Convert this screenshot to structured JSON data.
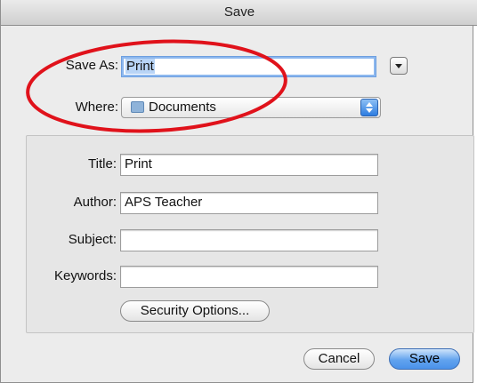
{
  "dialog": {
    "title": "Save",
    "save_as": {
      "label": "Save As:",
      "value": "Print"
    },
    "where": {
      "label": "Where:",
      "value": "Documents"
    },
    "metadata": {
      "title": {
        "label": "Title:",
        "value": "Print"
      },
      "author": {
        "label": "Author:",
        "value": "APS Teacher"
      },
      "subject": {
        "label": "Subject:",
        "value": ""
      },
      "keywords": {
        "label": "Keywords:",
        "value": ""
      }
    },
    "security_button": "Security Options...",
    "cancel_button": "Cancel",
    "save_button": "Save"
  },
  "annotation": {
    "color": "#e0121b"
  },
  "icons": {
    "disclosure": "triangle-down-icon",
    "folder": "folder-icon",
    "stepper": "popup-stepper-icon"
  },
  "colors": {
    "default_button": "#4a92ea",
    "selection": "#b8d4f6"
  }
}
